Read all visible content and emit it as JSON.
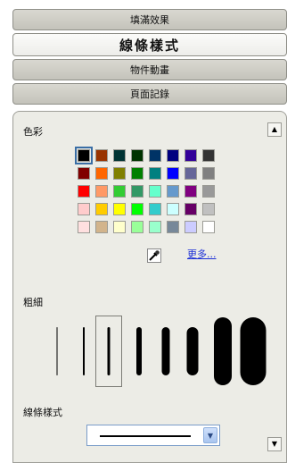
{
  "tabs": [
    {
      "label": "填滿效果",
      "active": false
    },
    {
      "label": "線條樣式",
      "active": true
    },
    {
      "label": "物件動畫",
      "active": false
    },
    {
      "label": "頁面記錄",
      "active": false
    }
  ],
  "color_section": {
    "label": "色彩",
    "more_label": "更多...",
    "swatches": [
      "#000000",
      "#993300",
      "#003333",
      "#003300",
      "#003366",
      "#000080",
      "#330099",
      "#333333",
      "#800000",
      "#ff6600",
      "#808000",
      "#008000",
      "#008080",
      "#0000ff",
      "#666699",
      "#808080",
      "#ff0000",
      "#ff9966",
      "#33cc33",
      "#339966",
      "#66ffcc",
      "#6699cc",
      "#800080",
      "#999999",
      "#ffcccc",
      "#ffcc00",
      "#ffff00",
      "#00ff00",
      "#33cccc",
      "#ccffff",
      "#660066",
      "#c0c0c0",
      "#ffe0e0",
      "#d2b48c",
      "#ffffcc",
      "#99ff99",
      "#99ffcc",
      "#778899",
      "#ccccff",
      "#ffffff"
    ],
    "selected_index": 0
  },
  "width_section": {
    "label": "粗細",
    "widths": [
      1,
      2,
      3,
      6,
      9,
      13,
      20,
      29
    ],
    "selected_index": 2
  },
  "style_section": {
    "label": "線條樣式",
    "selected": "solid"
  }
}
